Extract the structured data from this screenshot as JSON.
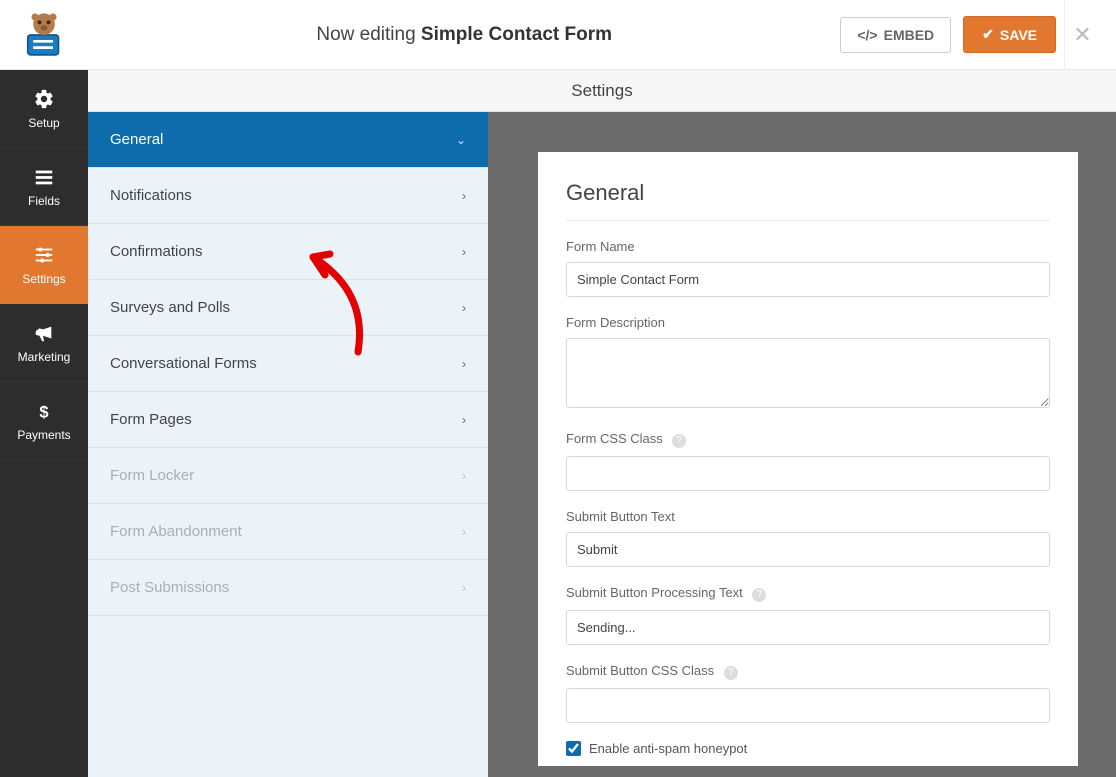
{
  "header": {
    "editing_prefix": "Now editing",
    "form_title": "Simple Contact Form",
    "embed_label": "EMBED",
    "save_label": "SAVE"
  },
  "sidebar": {
    "items": [
      {
        "id": "setup",
        "label": "Setup"
      },
      {
        "id": "fields",
        "label": "Fields"
      },
      {
        "id": "settings",
        "label": "Settings"
      },
      {
        "id": "marketing",
        "label": "Marketing"
      },
      {
        "id": "payments",
        "label": "Payments"
      }
    ],
    "active": "settings"
  },
  "pagebar": {
    "title": "Settings"
  },
  "subnav": {
    "items": [
      {
        "label": "General",
        "active": true,
        "disabled": false,
        "caret": "down"
      },
      {
        "label": "Notifications",
        "active": false,
        "disabled": false,
        "caret": "right"
      },
      {
        "label": "Confirmations",
        "active": false,
        "disabled": false,
        "caret": "right"
      },
      {
        "label": "Surveys and Polls",
        "active": false,
        "disabled": false,
        "caret": "right"
      },
      {
        "label": "Conversational Forms",
        "active": false,
        "disabled": false,
        "caret": "right"
      },
      {
        "label": "Form Pages",
        "active": false,
        "disabled": false,
        "caret": "right"
      },
      {
        "label": "Form Locker",
        "active": false,
        "disabled": true,
        "caret": "right"
      },
      {
        "label": "Form Abandonment",
        "active": false,
        "disabled": true,
        "caret": "right"
      },
      {
        "label": "Post Submissions",
        "active": false,
        "disabled": true,
        "caret": "right"
      }
    ]
  },
  "panel": {
    "heading": "General",
    "fields": {
      "form_name": {
        "label": "Form Name",
        "value": "Simple Contact Form",
        "help": false
      },
      "form_description": {
        "label": "Form Description",
        "value": "",
        "help": false
      },
      "form_css_class": {
        "label": "Form CSS Class",
        "value": "",
        "help": true
      },
      "submit_text": {
        "label": "Submit Button Text",
        "value": "Submit",
        "help": false
      },
      "submit_processing": {
        "label": "Submit Button Processing Text",
        "value": "Sending...",
        "help": true
      },
      "submit_css_class": {
        "label": "Submit Button CSS Class",
        "value": "",
        "help": true
      },
      "honeypot": {
        "label": "Enable anti-spam honeypot",
        "checked": true
      }
    }
  },
  "annotation": {
    "desc": "Red hand-drawn arrow pointing to General tab"
  }
}
